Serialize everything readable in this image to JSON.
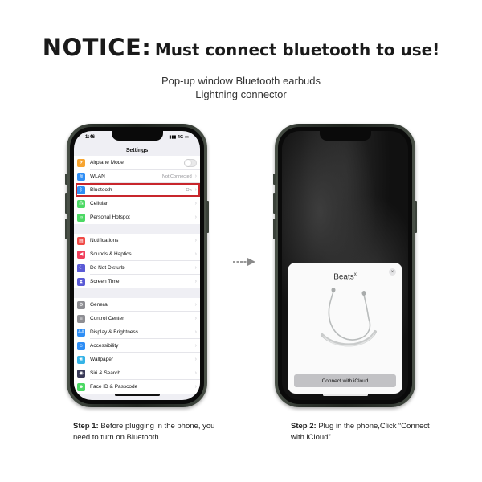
{
  "headline": {
    "notice": "NOTICE:",
    "rest": "Must connect bluetooth to use!"
  },
  "subtitle": {
    "line1": "Pop-up window Bluetooth earbuds",
    "line2": "Lightning connector"
  },
  "left_phone": {
    "status_time": "1:46",
    "status_signal": "4G",
    "settings_title": "Settings",
    "groups": [
      [
        {
          "label": "Airplane Mode",
          "icon": "airplane-icon",
          "color": "#f7a531",
          "glyph": "✈",
          "accessory": "toggle"
        },
        {
          "label": "WLAN",
          "icon": "wifi-icon",
          "color": "#2f8ef5",
          "glyph": "≋",
          "value": "Not Connected"
        },
        {
          "label": "Bluetooth",
          "icon": "bluetooth-icon",
          "color": "#2f8ef5",
          "glyph": "ᛒ",
          "value": "On",
          "highlight": true
        },
        {
          "label": "Cellular",
          "icon": "cellular-icon",
          "color": "#4cd964",
          "glyph": "⁂"
        },
        {
          "label": "Personal Hotspot",
          "icon": "hotspot-icon",
          "color": "#4cd964",
          "glyph": "∞"
        }
      ],
      [
        {
          "label": "Notifications",
          "icon": "notifications-icon",
          "color": "#f04a46",
          "glyph": "▤"
        },
        {
          "label": "Sounds & Haptics",
          "icon": "sound-icon",
          "color": "#f0405c",
          "glyph": "◀"
        },
        {
          "label": "Do Not Disturb",
          "icon": "moon-icon",
          "color": "#5b5bd6",
          "glyph": "☾"
        },
        {
          "label": "Screen Time",
          "icon": "hourglass-icon",
          "color": "#5b5bd6",
          "glyph": "⧗"
        }
      ],
      [
        {
          "label": "General",
          "icon": "gear-icon",
          "color": "#8e8e93",
          "glyph": "⚙"
        },
        {
          "label": "Control Center",
          "icon": "control-center-icon",
          "color": "#8e8e93",
          "glyph": "≡"
        },
        {
          "label": "Display & Brightness",
          "icon": "display-icon",
          "color": "#2f8ef5",
          "glyph": "AA"
        },
        {
          "label": "Accessibility",
          "icon": "accessibility-icon",
          "color": "#2f8ef5",
          "glyph": "☺"
        },
        {
          "label": "Wallpaper",
          "icon": "wallpaper-icon",
          "color": "#35b3e6",
          "glyph": "❀"
        },
        {
          "label": "Siri & Search",
          "icon": "siri-icon",
          "color": "#3a3a58",
          "glyph": "◉"
        },
        {
          "label": "Face ID & Passcode",
          "icon": "face-id-icon",
          "color": "#4cd964",
          "glyph": "☻"
        }
      ]
    ]
  },
  "right_phone": {
    "popup_brand": "Beats",
    "popup_brand_mark": "x",
    "close_glyph": "×",
    "connect_label": "Connect with iCloud"
  },
  "steps": {
    "step1_label": "Step 1:",
    "step1_text": " Before plugging in the phone, you need to turn on Bluetooth.",
    "step2_label": "Step 2:",
    "step2_text": " Plug in the phone,Click “Connect with iCloud”."
  }
}
